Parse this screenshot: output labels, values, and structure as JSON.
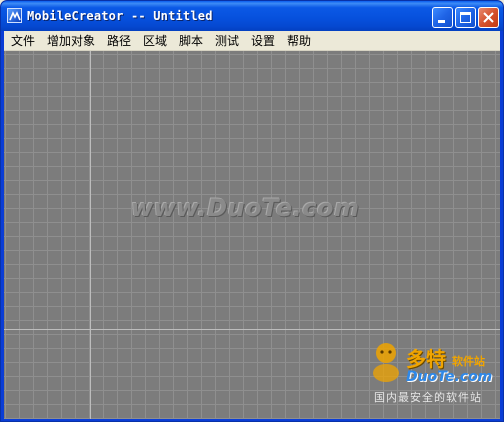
{
  "window": {
    "title": "MobileCreator -- Untitled",
    "icon": "app-icon"
  },
  "title_buttons": {
    "minimize": "minimize-icon",
    "maximize": "maximize-icon",
    "close": "close-icon"
  },
  "menu": {
    "items": [
      {
        "label": "文件"
      },
      {
        "label": "增加对象"
      },
      {
        "label": "路径"
      },
      {
        "label": "区域"
      },
      {
        "label": "脚本"
      },
      {
        "label": "测试"
      },
      {
        "label": "设置"
      },
      {
        "label": "帮助"
      }
    ]
  },
  "canvas": {
    "background_color": "#7c7c7c",
    "grid_color": "#8f8f8f",
    "guide_color": "#bdbdbd"
  },
  "watermark": {
    "main": "www.DuoTe.com",
    "logo_title": "多特",
    "logo_sub": "软件站",
    "logo_domain": "DuoTe.com",
    "slogan": "国内最安全的软件站"
  }
}
